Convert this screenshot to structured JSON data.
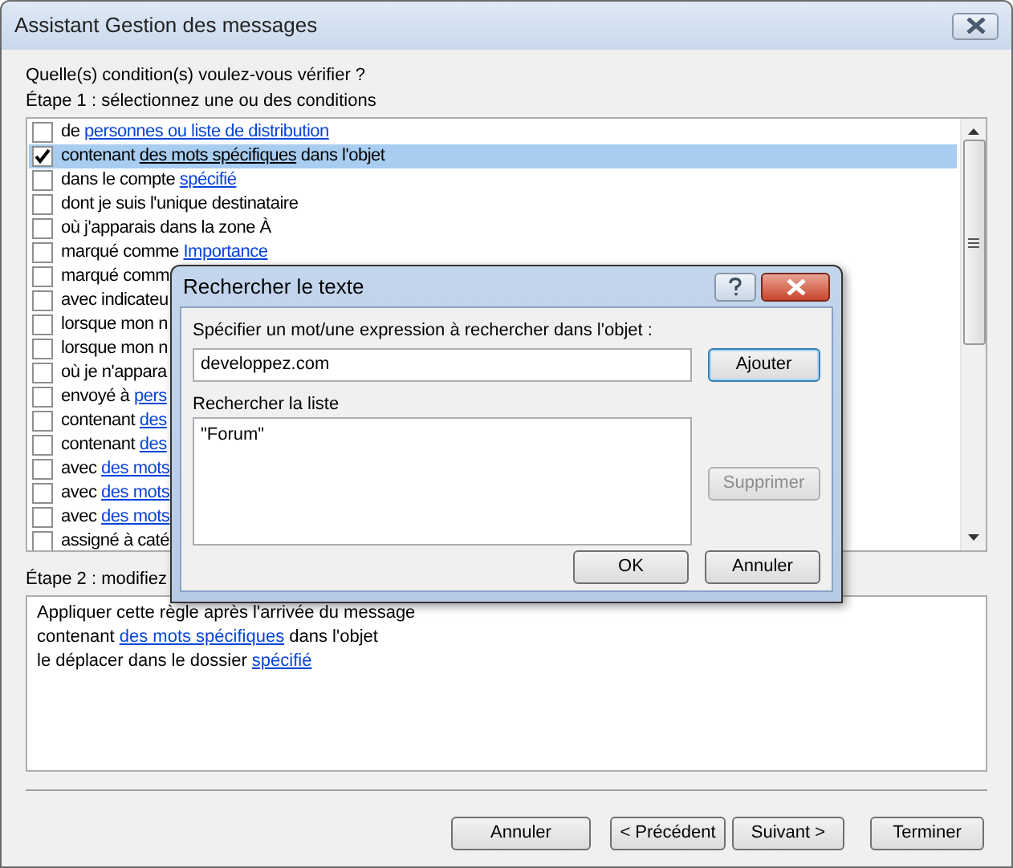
{
  "window": {
    "title": "Assistant Gestion des messages"
  },
  "question": "Quelle(s) condition(s) voulez-vous vérifier ?",
  "step1_label": "Étape 1 : sélectionnez une ou des conditions",
  "conditions": [
    {
      "checked": false,
      "selected": false,
      "parts": [
        {
          "text": "de ",
          "link": false
        },
        {
          "text": "personnes ou liste de distribution",
          "link": true
        }
      ]
    },
    {
      "checked": true,
      "selected": true,
      "parts": [
        {
          "text": "contenant ",
          "link": false
        },
        {
          "text": "des mots spécifiques",
          "link": true
        },
        {
          "text": " dans l'objet",
          "link": false
        }
      ]
    },
    {
      "checked": false,
      "selected": false,
      "parts": [
        {
          "text": "dans le compte ",
          "link": false
        },
        {
          "text": "spécifié",
          "link": true
        }
      ]
    },
    {
      "checked": false,
      "selected": false,
      "parts": [
        {
          "text": "dont je suis l'unique destinataire",
          "link": false
        }
      ]
    },
    {
      "checked": false,
      "selected": false,
      "parts": [
        {
          "text": "où j'apparais dans la zone À",
          "link": false
        }
      ]
    },
    {
      "checked": false,
      "selected": false,
      "parts": [
        {
          "text": "marqué comme ",
          "link": false
        },
        {
          "text": "Importance",
          "link": true
        }
      ]
    },
    {
      "checked": false,
      "selected": false,
      "parts": [
        {
          "text": "marqué comm",
          "link": false
        }
      ]
    },
    {
      "checked": false,
      "selected": false,
      "parts": [
        {
          "text": "avec indicateu",
          "link": false
        }
      ]
    },
    {
      "checked": false,
      "selected": false,
      "parts": [
        {
          "text": "lorsque mon n",
          "link": false
        }
      ]
    },
    {
      "checked": false,
      "selected": false,
      "parts": [
        {
          "text": "lorsque mon n",
          "link": false
        }
      ]
    },
    {
      "checked": false,
      "selected": false,
      "parts": [
        {
          "text": "où je n'appara",
          "link": false
        }
      ]
    },
    {
      "checked": false,
      "selected": false,
      "parts": [
        {
          "text": "envoyé à ",
          "link": false
        },
        {
          "text": "pers",
          "link": true
        }
      ]
    },
    {
      "checked": false,
      "selected": false,
      "parts": [
        {
          "text": "contenant ",
          "link": false
        },
        {
          "text": "des",
          "link": true
        }
      ]
    },
    {
      "checked": false,
      "selected": false,
      "parts": [
        {
          "text": "contenant ",
          "link": false
        },
        {
          "text": "des",
          "link": true
        }
      ]
    },
    {
      "checked": false,
      "selected": false,
      "parts": [
        {
          "text": "avec ",
          "link": false
        },
        {
          "text": "des mots",
          "link": true
        }
      ]
    },
    {
      "checked": false,
      "selected": false,
      "parts": [
        {
          "text": "avec ",
          "link": false
        },
        {
          "text": "des mots",
          "link": true
        }
      ]
    },
    {
      "checked": false,
      "selected": false,
      "parts": [
        {
          "text": "avec ",
          "link": false
        },
        {
          "text": "des mots",
          "link": true
        }
      ]
    },
    {
      "checked": false,
      "selected": false,
      "parts": [
        {
          "text": "assigné à caté",
          "link": false
        }
      ]
    }
  ],
  "step2_label": "Étape 2 : modifiez",
  "description": [
    [
      {
        "text": "Appliquer cette règle après l'arrivée du message",
        "link": false
      }
    ],
    [
      {
        "text": "contenant ",
        "link": false
      },
      {
        "text": "des mots spécifiques",
        "link": true
      },
      {
        "text": " dans l'objet",
        "link": false
      }
    ],
    [
      {
        "text": "le déplacer dans le dossier ",
        "link": false
      },
      {
        "text": "spécifié",
        "link": true
      }
    ]
  ],
  "buttons": [
    {
      "label": "Annuler"
    },
    {
      "label": "< Précédent"
    },
    {
      "label": "Suivant >"
    },
    {
      "label": "Terminer"
    }
  ],
  "dialog": {
    "title": "Rechercher le texte",
    "prompt": "Spécifier un mot/une expression à rechercher dans l'objet :",
    "value": "developpez.com",
    "add_button": "Ajouter",
    "list_label": "Rechercher la liste",
    "list_items": [
      "\"Forum\""
    ],
    "remove_button": {
      "label": "Supprimer",
      "disabled": true
    },
    "ok_button": "OK",
    "cancel_button": "Annuler"
  }
}
